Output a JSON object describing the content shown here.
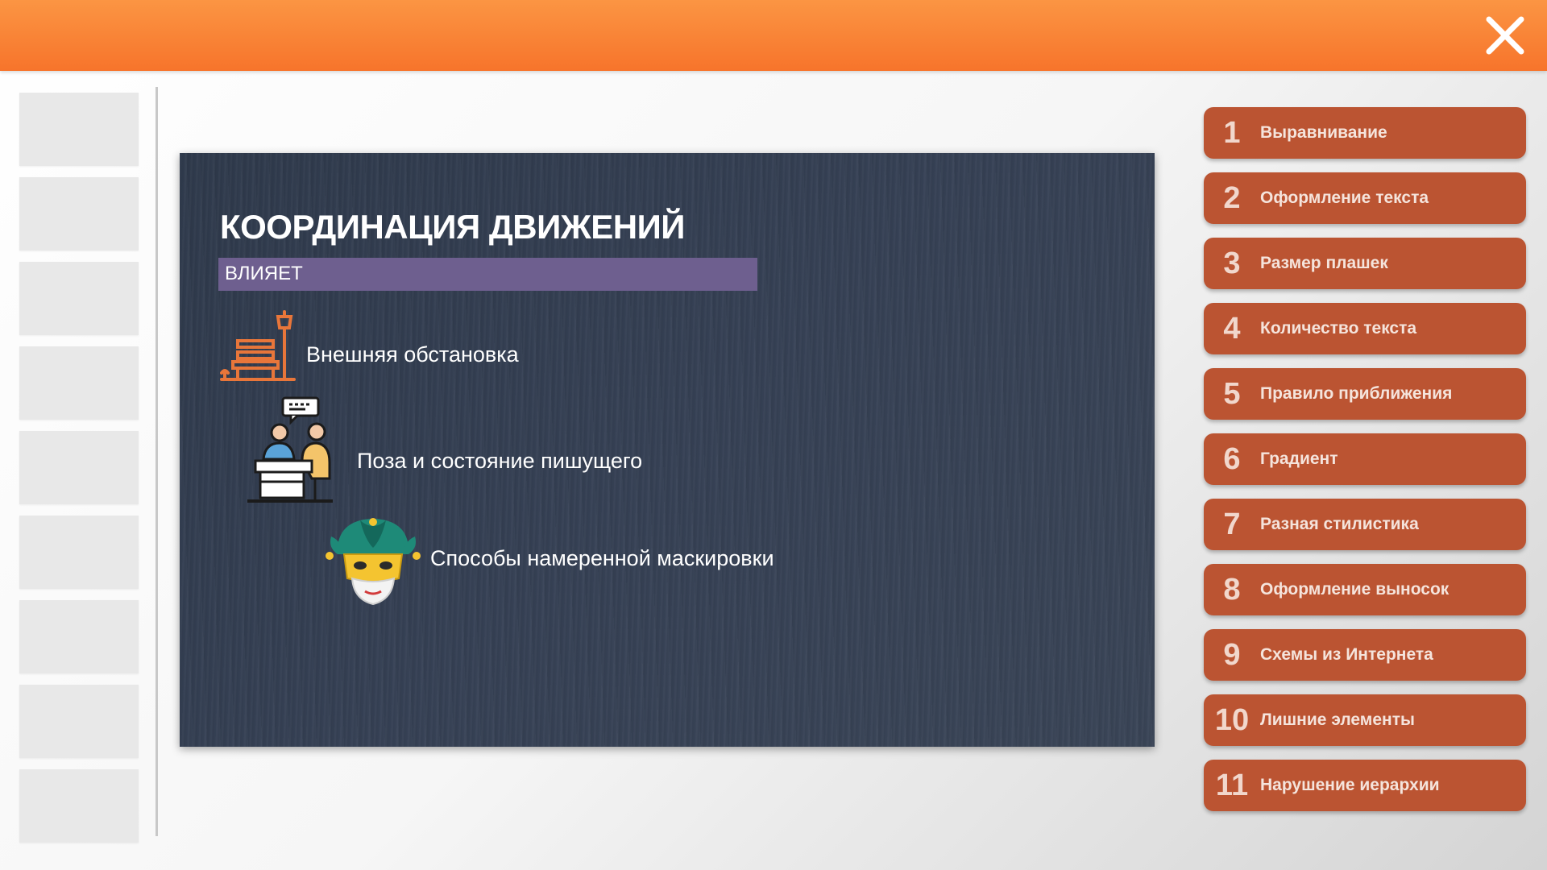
{
  "header": {
    "close_icon": "close-icon"
  },
  "thumbnails": {
    "count": 9
  },
  "slide": {
    "title": "КООРДИНАЦИЯ ДВИЖЕНИЙ",
    "subtitle_bar": "ВЛИЯЕТ",
    "items": [
      {
        "text": "Внешняя обстановка",
        "icon": "park-bench-icon"
      },
      {
        "text": "Поза и состояние пишущего",
        "icon": "people-at-desk-icon"
      },
      {
        "text": "Способы намеренной маскировки",
        "icon": "jester-mask-icon"
      }
    ]
  },
  "menu": {
    "items": [
      {
        "num": "1",
        "label": "Выравнивание"
      },
      {
        "num": "2",
        "label": "Оформление текста"
      },
      {
        "num": "3",
        "label": "Размер плашек"
      },
      {
        "num": "4",
        "label": "Количество текста"
      },
      {
        "num": "5",
        "label": "Правило приближения"
      },
      {
        "num": "6",
        "label": "Градиент"
      },
      {
        "num": "7",
        "label": "Разная стилистика"
      },
      {
        "num": "8",
        "label": "Оформление выносок"
      },
      {
        "num": "9",
        "label": "Схемы из Интернета"
      },
      {
        "num": "10",
        "label": "Лишние элементы"
      },
      {
        "num": "11",
        "label": "Нарушение иерархии"
      }
    ]
  },
  "colors": {
    "header_orange": "#f7742b",
    "menu_button": "#bb5432",
    "slide_background": "#343f52",
    "slide_bar_purple": "#6e5f8f",
    "icon_orange": "#e8763a"
  }
}
